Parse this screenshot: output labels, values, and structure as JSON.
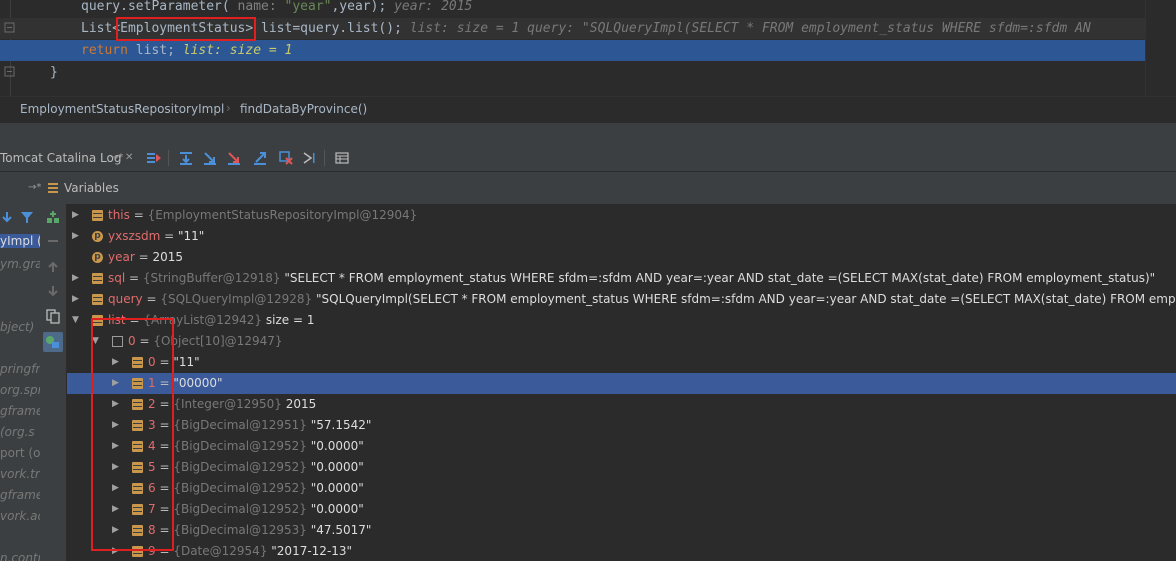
{
  "editor": {
    "line1": {
      "method": "query.setParameter(",
      "hint": "name:",
      "arg1": "\"year\"",
      "rest": ",year);",
      "inline": "year: 2015"
    },
    "line2": {
      "type_prefix": "List<",
      "type_name": "EmploymentStatus",
      "type_suffix": ">",
      "assign": "list=query.list();",
      "inline": "list:  size = 1   query: \"SQLQueryImpl(SELECT * FROM employment_status WHERE sfdm=:sfdm  AN"
    },
    "line3": {
      "keyword": "return",
      "code": "list;",
      "inline": "list:  size = 1"
    },
    "line4": {
      "brace": "}"
    }
  },
  "breadcrumb": {
    "class_name": "EmploymentStatusRepositoryImpl",
    "separator": "›",
    "method_name": "findDataByProvince()"
  },
  "debug_toolbar": {
    "tab_label": "Tomcat Catalina Log",
    "tab_pin": "→*",
    "tab_close": "✕"
  },
  "variables_panel": {
    "pin": "→*",
    "title": "Variables"
  },
  "frames": {
    "items": [
      "yImpl (c",
      "ym.gra",
      "bject)",
      "pringfra",
      "org.sprin",
      "gframe",
      "(org.s",
      "port (o",
      "vork.tra",
      "gframe",
      "vork.ac",
      "n.contro"
    ]
  },
  "variables": [
    {
      "name": "this",
      "type": "{EmploymentStatusRepositoryImpl@12904}",
      "value": "",
      "icon": "field-icon",
      "expand": "▶"
    },
    {
      "name": "yxszsdm",
      "type": "",
      "value": "\"11\"",
      "icon": "param-icon",
      "expand": "▶"
    },
    {
      "name": "year",
      "type": "",
      "value": "2015",
      "icon": "param-icon",
      "expand": ""
    },
    {
      "name": "sql",
      "type": "{StringBuffer@12918}",
      "value": "\"SELECT * FROM employment_status WHERE sfdm=:sfdm  AND year=:year  AND stat_date =(SELECT MAX(stat_date) FROM employment_status)\"",
      "icon": "field-icon",
      "expand": "▶"
    },
    {
      "name": "query",
      "type": "{SQLQueryImpl@12928}",
      "value": "\"SQLQueryImpl(SELECT * FROM employment_status WHERE sfdm=:sfdm  AND year=:year  AND stat_date =(SELECT MAX(stat_date) FROM employment_status)\"",
      "icon": "field-icon",
      "expand": "▶"
    },
    {
      "name": "list",
      "type": "{ArrayList@12942}",
      "value": "size = 1",
      "icon": "field-icon",
      "expand": "▼"
    },
    {
      "name": "0",
      "type": "{Object[10]@12947}",
      "value": "",
      "icon": "array-icon",
      "expand": "▼"
    },
    {
      "name": "0",
      "type": "",
      "value": "\"11\"",
      "icon": "field-icon",
      "expand": "▶"
    },
    {
      "name": "1",
      "type": "",
      "value": "\"00000\"",
      "icon": "field-icon",
      "expand": "▶"
    },
    {
      "name": "2",
      "type": "{Integer@12950}",
      "value": "2015",
      "icon": "field-icon",
      "expand": "▶"
    },
    {
      "name": "3",
      "type": "{BigDecimal@12951}",
      "value": "\"57.1542\"",
      "icon": "field-icon",
      "expand": "▶"
    },
    {
      "name": "4",
      "type": "{BigDecimal@12952}",
      "value": "\"0.0000\"",
      "icon": "field-icon",
      "expand": "▶"
    },
    {
      "name": "5",
      "type": "{BigDecimal@12952}",
      "value": "\"0.0000\"",
      "icon": "field-icon",
      "expand": "▶"
    },
    {
      "name": "6",
      "type": "{BigDecimal@12952}",
      "value": "\"0.0000\"",
      "icon": "field-icon",
      "expand": "▶"
    },
    {
      "name": "7",
      "type": "{BigDecimal@12952}",
      "value": "\"0.0000\"",
      "icon": "field-icon",
      "expand": "▶"
    },
    {
      "name": "8",
      "type": "{BigDecimal@12953}",
      "value": "\"47.5017\"",
      "icon": "field-icon",
      "expand": "▶"
    },
    {
      "name": "9",
      "type": "{Date@12954}",
      "value": "\"2017-12-13\"",
      "icon": "field-icon",
      "expand": "▶"
    }
  ],
  "colors": {
    "selection": "#3b5a9a",
    "highlight_line": "#2d5694",
    "annotation_red": "#e02020"
  }
}
